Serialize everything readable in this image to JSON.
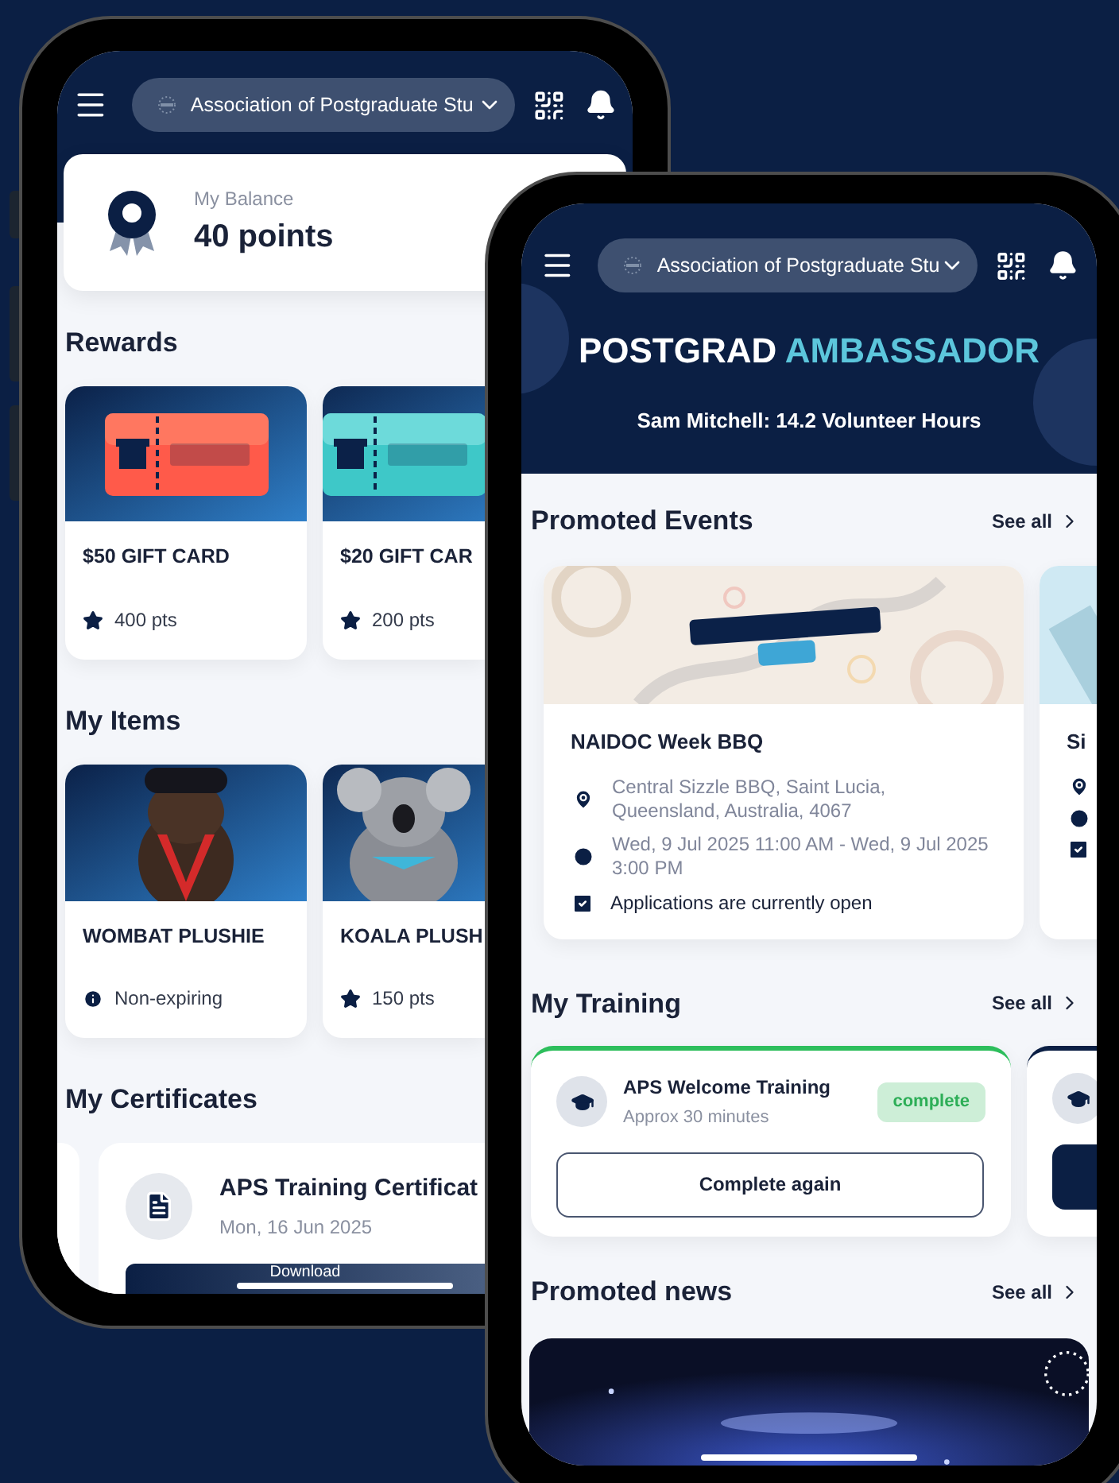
{
  "left_phone": {
    "header": {
      "organization": "Association of Postgraduate Stu"
    },
    "balance": {
      "label": "My Balance",
      "value": "40 points"
    },
    "rewards": {
      "title": "Rewards",
      "cards": [
        {
          "title": "$50 GIFT CARD",
          "meta": "400 pts",
          "kind": "points"
        },
        {
          "title": "$20 GIFT CAR",
          "meta": "200 pts",
          "kind": "points"
        }
      ]
    },
    "items": {
      "title": "My Items",
      "cards": [
        {
          "title": "WOMBAT PLUSHIE",
          "meta": "Non-expiring",
          "kind": "non_expiring"
        },
        {
          "title": "KOALA PLUSH",
          "meta": "150 pts",
          "kind": "points"
        }
      ]
    },
    "certificates": {
      "title": "My Certificates",
      "cards": [
        {
          "title": "APS Training Certificat",
          "date": "Mon, 16 Jun 2025",
          "button": "Download"
        }
      ]
    }
  },
  "right_phone": {
    "header": {
      "organization": "Association of Postgraduate Stu"
    },
    "hero": {
      "title": "POSTGRAD",
      "title_highlight": "AMBASSADOR",
      "subtitle": "Sam Mitchell: 14.2 Volunteer Hours"
    },
    "events": {
      "title": "Promoted Events",
      "see_all": "See all",
      "cards": [
        {
          "title": "NAIDOC Week BBQ",
          "location": "Central Sizzle BBQ, Saint Lucia, Queensland, Australia, 4067",
          "time": "Wed, 9 Jul 2025 11:00 AM - Wed, 9 Jul 2025 3:00 PM",
          "status": "Applications are currently open",
          "checked": true
        },
        {
          "title": "Si",
          "checked": true
        }
      ]
    },
    "training": {
      "title": "My Training",
      "see_all": "See all",
      "cards": [
        {
          "title": "APS Welcome Training",
          "duration": "Approx 30 minutes",
          "status": "complete",
          "button": "Complete again",
          "complete": true
        },
        {
          "complete": false
        }
      ]
    },
    "news": {
      "title": "Promoted news",
      "see_all": "See all"
    }
  }
}
